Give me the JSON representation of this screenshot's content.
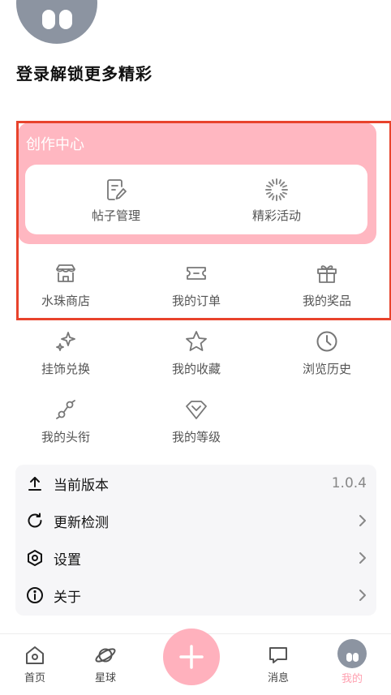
{
  "profile": {
    "login_prompt": "登录解锁更多精彩"
  },
  "creator": {
    "title": "创作中心",
    "items": [
      {
        "label": "帖子管理",
        "icon": "edit-document-icon"
      },
      {
        "label": "精彩活动",
        "icon": "sparkle-loading-icon"
      }
    ]
  },
  "features": [
    {
      "label": "水珠商店",
      "icon": "store-icon"
    },
    {
      "label": "我的订单",
      "icon": "ticket-icon"
    },
    {
      "label": "我的奖品",
      "icon": "gift-icon"
    },
    {
      "label": "挂饰兑换",
      "icon": "sparkles-icon"
    },
    {
      "label": "我的收藏",
      "icon": "star-icon"
    },
    {
      "label": "浏览历史",
      "icon": "clock-icon"
    },
    {
      "label": "我的头衔",
      "icon": "badge-tag-icon"
    },
    {
      "label": "我的等级",
      "icon": "heart-level-icon"
    }
  ],
  "settings": {
    "items": [
      {
        "label": "当前版本",
        "value": "1.0.4",
        "icon": "upload-icon"
      },
      {
        "label": "更新检测",
        "icon": "refresh-icon"
      },
      {
        "label": "设置",
        "icon": "hexagon-settings-icon"
      },
      {
        "label": "关于",
        "icon": "info-icon"
      }
    ]
  },
  "tabbar": {
    "items": [
      {
        "label": "首页",
        "icon": "home-icon"
      },
      {
        "label": "星球",
        "icon": "planet-icon"
      },
      {
        "label": "消息",
        "icon": "message-icon"
      },
      {
        "label": "我的",
        "icon": "avatar-icon",
        "active": true
      }
    ],
    "fab_icon": "plus-icon"
  },
  "colors": {
    "accent_pink": "#ffb7c1",
    "highlight_border": "#e8432c",
    "active_tab": "#ffa0b0"
  }
}
